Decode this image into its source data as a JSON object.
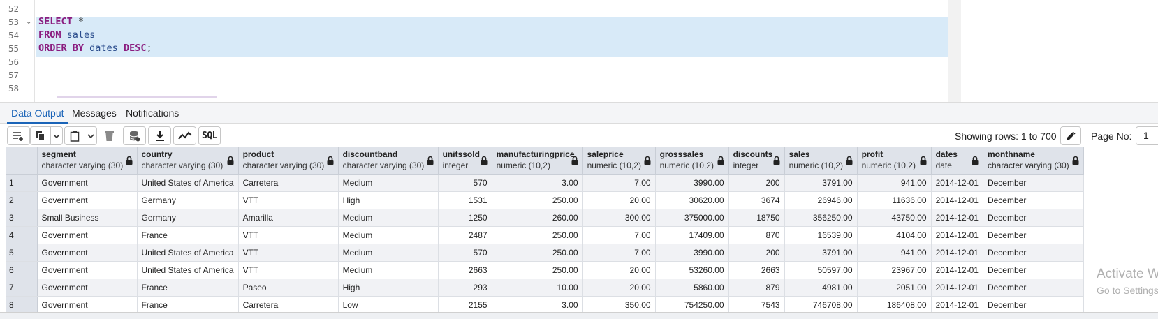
{
  "editor": {
    "line_numbers": [
      "52",
      "53",
      "54",
      "55",
      "56",
      "57",
      "58"
    ],
    "code": {
      "select": "SELECT",
      "star": "*",
      "from": "FROM",
      "table": "sales",
      "order_by": "ORDER BY",
      "column": "dates",
      "desc": "DESC",
      "semicolon": ";"
    }
  },
  "tabs": [
    "Data Output",
    "Messages",
    "Notifications"
  ],
  "toolbar": {
    "sql_label": "SQL",
    "rows_info": "Showing rows: 1 to 700",
    "page_label": "Page No:",
    "page_value": "1"
  },
  "grid": {
    "columns": [
      {
        "name": "segment",
        "type": "character varying (30)"
      },
      {
        "name": "country",
        "type": "character varying (30)"
      },
      {
        "name": "product",
        "type": "character varying (30)"
      },
      {
        "name": "discountband",
        "type": "character varying (30)"
      },
      {
        "name": "unitssold",
        "type": "integer"
      },
      {
        "name": "manufacturingprice",
        "type": "numeric (10,2)"
      },
      {
        "name": "saleprice",
        "type": "numeric (10,2)"
      },
      {
        "name": "grosssales",
        "type": "numeric (10,2)"
      },
      {
        "name": "discounts",
        "type": "integer"
      },
      {
        "name": "sales",
        "type": "numeric (10,2)"
      },
      {
        "name": "profit",
        "type": "numeric (10,2)"
      },
      {
        "name": "dates",
        "type": "date"
      },
      {
        "name": "monthname",
        "type": "character varying (30)"
      }
    ],
    "rows": [
      {
        "n": "1",
        "cells": [
          "Government",
          "United States of America",
          "Carretera",
          "Medium",
          "570",
          "3.00",
          "7.00",
          "3990.00",
          "200",
          "3791.00",
          "941.00",
          "2014-12-01",
          "December"
        ]
      },
      {
        "n": "2",
        "cells": [
          "Government",
          "Germany",
          "VTT",
          "High",
          "1531",
          "250.00",
          "20.00",
          "30620.00",
          "3674",
          "26946.00",
          "11636.00",
          "2014-12-01",
          "December"
        ]
      },
      {
        "n": "3",
        "cells": [
          "Small Business",
          "Germany",
          "Amarilla",
          "Medium",
          "1250",
          "260.00",
          "300.00",
          "375000.00",
          "18750",
          "356250.00",
          "43750.00",
          "2014-12-01",
          "December"
        ]
      },
      {
        "n": "4",
        "cells": [
          "Government",
          "France",
          "VTT",
          "Medium",
          "2487",
          "250.00",
          "7.00",
          "17409.00",
          "870",
          "16539.00",
          "4104.00",
          "2014-12-01",
          "December"
        ]
      },
      {
        "n": "5",
        "cells": [
          "Government",
          "United States of America",
          "VTT",
          "Medium",
          "570",
          "250.00",
          "7.00",
          "3990.00",
          "200",
          "3791.00",
          "941.00",
          "2014-12-01",
          "December"
        ]
      },
      {
        "n": "6",
        "cells": [
          "Government",
          "United States of America",
          "VTT",
          "Medium",
          "2663",
          "250.00",
          "20.00",
          "53260.00",
          "2663",
          "50597.00",
          "23967.00",
          "2014-12-01",
          "December"
        ]
      },
      {
        "n": "7",
        "cells": [
          "Government",
          "France",
          "Paseo",
          "High",
          "293",
          "10.00",
          "20.00",
          "5860.00",
          "879",
          "4981.00",
          "2051.00",
          "2014-12-01",
          "December"
        ]
      },
      {
        "n": "8",
        "cells": [
          "Government",
          "France",
          "Carretera",
          "Low",
          "2155",
          "3.00",
          "350.00",
          "754250.00",
          "7543",
          "746708.00",
          "186408.00",
          "2014-12-01",
          "December"
        ]
      }
    ]
  },
  "watermark": {
    "line1": "Activate W",
    "line2": "Go to Settings"
  }
}
